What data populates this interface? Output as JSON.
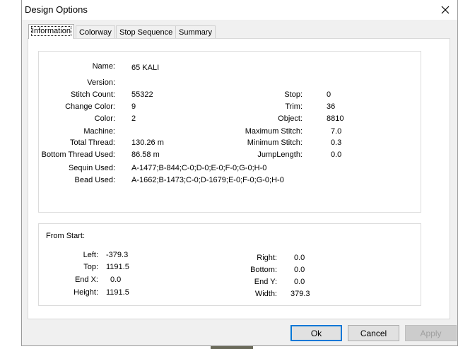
{
  "window": {
    "title": "Design Options"
  },
  "tabs": [
    {
      "label": "Information",
      "active": true
    },
    {
      "label": "Colorway",
      "active": false
    },
    {
      "label": "Stop Sequence",
      "active": false
    },
    {
      "label": "Summary",
      "active": false
    }
  ],
  "info": {
    "name": {
      "label": "Name:",
      "value": "65 KALI"
    },
    "version": {
      "label": "Version:",
      "value": ""
    },
    "stitch_count": {
      "label": "Stitch Count:",
      "value": "55322"
    },
    "change_color": {
      "label": "Change Color:",
      "value": "9"
    },
    "color": {
      "label": "Color:",
      "value": "2"
    },
    "machine": {
      "label": "Machine:",
      "value": ""
    },
    "total_thread": {
      "label": "Total Thread:",
      "value": "130.26 m"
    },
    "bottom_thread": {
      "label": "Bottom Thread Used:",
      "value": "86.58 m"
    },
    "sequin_used": {
      "label": "Sequin Used:",
      "value": "A-1477;B-844;C-0;D-0;E-0;F-0;G-0;H-0"
    },
    "bead_used": {
      "label": "Bead Used:",
      "value": "A-1662;B-1473;C-0;D-1679;E-0;F-0;G-0;H-0"
    },
    "stop": {
      "label": "Stop:",
      "value": "0"
    },
    "trim": {
      "label": "Trim:",
      "value": "36"
    },
    "object": {
      "label": "Object:",
      "value": "8810"
    },
    "max_stitch": {
      "label": "Maximum Stitch:",
      "value": "7.0"
    },
    "min_stitch": {
      "label": "Minimum Stitch:",
      "value": "0.3"
    },
    "jump_length": {
      "label": "JumpLength:",
      "value": "0.0"
    }
  },
  "from_start": {
    "heading": "From Start:",
    "left": {
      "label": "Left:",
      "value": "-379.3"
    },
    "top": {
      "label": "Top:",
      "value": "1191.5"
    },
    "end_x": {
      "label": "End X:",
      "value": "0.0"
    },
    "height": {
      "label": "Height:",
      "value": "1191.5"
    },
    "right": {
      "label": "Right:",
      "value": "0.0"
    },
    "bottom": {
      "label": "Bottom:",
      "value": "0.0"
    },
    "end_y": {
      "label": "End Y:",
      "value": "0.0"
    },
    "width": {
      "label": "Width:",
      "value": "379.3"
    }
  },
  "buttons": {
    "ok": "Ok",
    "cancel": "Cancel",
    "apply": "Apply"
  },
  "icons": {
    "close": "close-icon"
  },
  "colors": {
    "accent": "#0078d7",
    "dialog_bg": "#f0f0f0",
    "panel_bg": "#ffffff"
  }
}
